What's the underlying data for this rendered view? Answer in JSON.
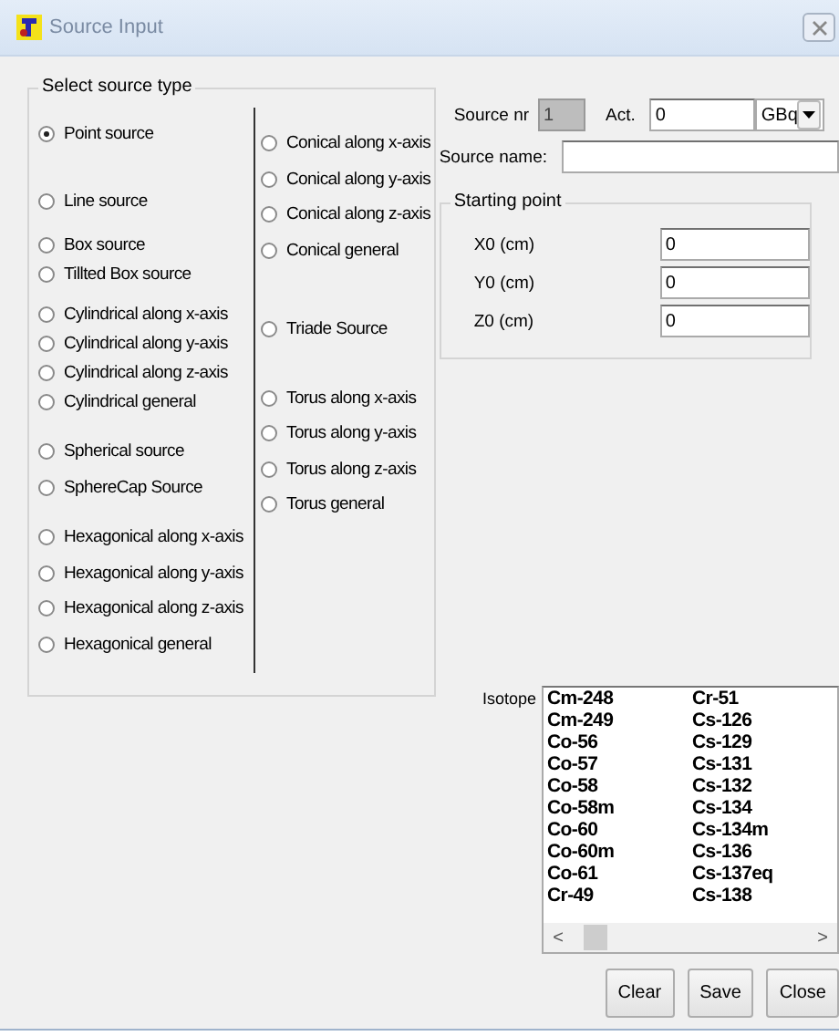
{
  "window": {
    "title": "Source Input"
  },
  "source_type": {
    "legend": "Select source type",
    "columns": [
      {
        "groups": [
          [
            {
              "label": "Point source",
              "selected": true
            }
          ],
          [
            {
              "label": "Line source",
              "selected": false
            }
          ],
          [
            {
              "label": "Box source",
              "selected": false
            },
            {
              "label": "Tillted Box source",
              "selected": false
            }
          ],
          [
            {
              "label": "Cylindrical along x-axis",
              "selected": false
            },
            {
              "label": "Cylindrical along y-axis",
              "selected": false
            },
            {
              "label": "Cylindrical along z-axis",
              "selected": false
            },
            {
              "label": "Cylindrical general",
              "selected": false
            }
          ],
          [
            {
              "label": "Spherical source",
              "selected": false
            },
            {
              "label": "SphereCap Source",
              "selected": false
            }
          ],
          [
            {
              "label": "Hexagonical along x-axis",
              "selected": false
            },
            {
              "label": "Hexagonical along y-axis",
              "selected": false
            },
            {
              "label": "Hexagonical along z-axis",
              "selected": false
            },
            {
              "label": "Hexagonical general",
              "selected": false
            }
          ]
        ]
      },
      {
        "groups": [
          [
            {
              "label": "Conical along x-axis",
              "selected": false
            },
            {
              "label": "Conical along y-axis",
              "selected": false
            },
            {
              "label": "Conical along z-axis",
              "selected": false
            },
            {
              "label": "Conical general",
              "selected": false
            }
          ],
          [
            {
              "label": "Triade Source",
              "selected": false
            }
          ],
          [
            {
              "label": "Torus along x-axis",
              "selected": false
            },
            {
              "label": "Torus along y-axis",
              "selected": false
            },
            {
              "label": "Torus along z-axis",
              "selected": false
            },
            {
              "label": "Torus general",
              "selected": false
            }
          ]
        ]
      }
    ]
  },
  "source_nr": {
    "label": "Source nr",
    "value": "1",
    "disabled": true
  },
  "activity": {
    "label": "Act.",
    "value": "0",
    "unit": "GBq"
  },
  "source_name": {
    "label": "Source name:"
  },
  "starting_point": {
    "legend": "Starting point",
    "fields": [
      {
        "label": "X0 (cm)",
        "value": "0"
      },
      {
        "label": "Y0 (cm)",
        "value": "0"
      },
      {
        "label": "Z0 (cm)",
        "value": "0"
      }
    ]
  },
  "isotope": {
    "label": "Isotope",
    "columns": [
      [
        "Cm-248",
        "Cm-249",
        "Co-56",
        "Co-57",
        "Co-58",
        "Co-58m",
        "Co-60",
        "Co-60m",
        "Co-61",
        "Cr-49"
      ],
      [
        "Cr-51",
        "Cs-126",
        "Cs-129",
        "Cs-131",
        "Cs-132",
        "Cs-134",
        "Cs-134m",
        "Cs-136",
        "Cs-137eq",
        "Cs-138"
      ]
    ],
    "scroll_left": "<",
    "scroll_right": ">"
  },
  "buttons": [
    "Clear",
    "Save",
    "Close"
  ]
}
